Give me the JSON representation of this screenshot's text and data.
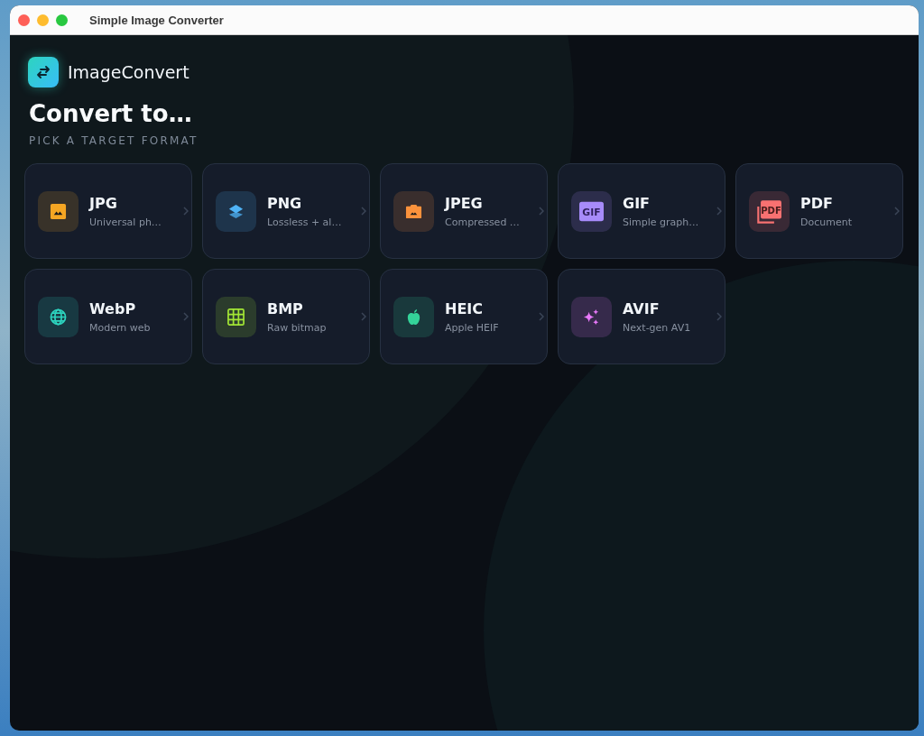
{
  "window": {
    "title": "Simple Image Converter"
  },
  "app": {
    "name": "ImageConvert"
  },
  "heading": "Convert to…",
  "subheading": "PICK A TARGET FORMAT",
  "formats": [
    {
      "name": "JPG",
      "description": "Universal ph…",
      "kind": "image",
      "color": "#f5a623"
    },
    {
      "name": "PNG",
      "description": "Lossless + al…",
      "kind": "layers",
      "color": "#4fb3f6"
    },
    {
      "name": "JPEG",
      "description": "Compressed …",
      "kind": "camera",
      "color": "#fb923c"
    },
    {
      "name": "GIF",
      "description": "Simple graph…",
      "kind": "gif",
      "color": "#a78bfa",
      "icon_label": "GIF"
    },
    {
      "name": "PDF",
      "description": "Document",
      "kind": "pdf",
      "color": "#f87171",
      "icon_label": "PDF"
    },
    {
      "name": "WebP",
      "description": "Modern web",
      "kind": "globe",
      "color": "#2dd4bf"
    },
    {
      "name": "BMP",
      "description": "Raw bitmap",
      "kind": "grid",
      "color": "#a3e635"
    },
    {
      "name": "HEIC",
      "description": "Apple HEIF",
      "kind": "apple",
      "color": "#34d399"
    },
    {
      "name": "AVIF",
      "description": "Next-gen AV1",
      "kind": "sparkle",
      "color": "#e879f9"
    }
  ]
}
